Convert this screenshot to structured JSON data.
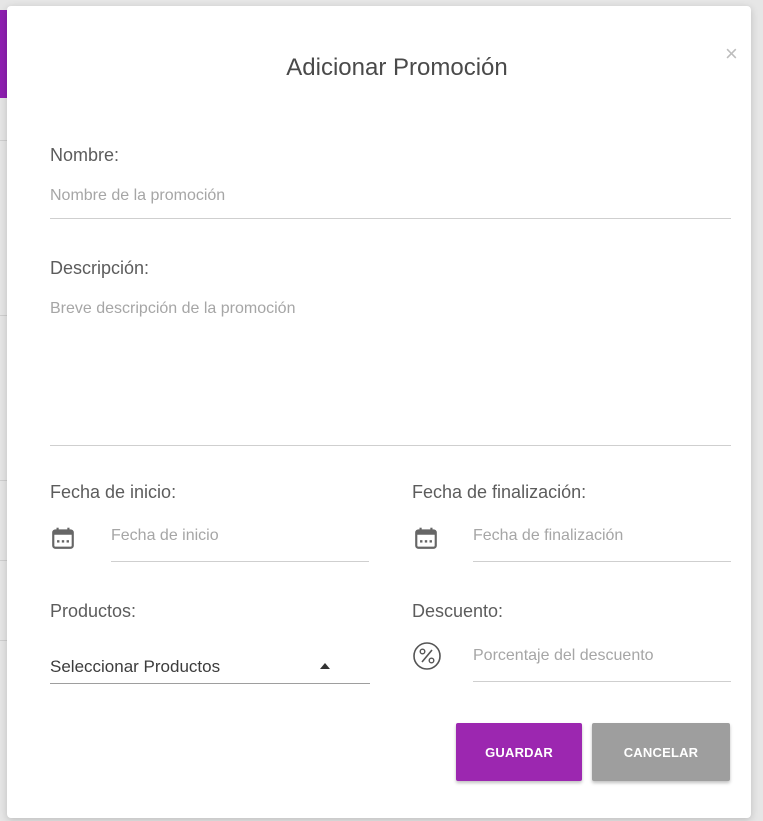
{
  "dialog": {
    "title": "Adicionar Promoción",
    "close_symbol": "×"
  },
  "form": {
    "name": {
      "label": "Nombre:",
      "placeholder": "Nombre de la promoción"
    },
    "description": {
      "label": "Descripción:",
      "placeholder": "Breve descripción de la promoción"
    },
    "start_date": {
      "label": "Fecha de inicio:",
      "placeholder": "Fecha de inicio",
      "icon": "calendar-icon"
    },
    "end_date": {
      "label": "Fecha de finalización:",
      "placeholder": "Fecha de finalización",
      "icon": "calendar-icon"
    },
    "products": {
      "label": "Productos:",
      "selected": "Seleccionar Productos",
      "icon": "caret-up-icon"
    },
    "discount": {
      "label": "Descuento:",
      "placeholder": "Porcentaje del descuento",
      "icon": "percent-icon"
    }
  },
  "actions": {
    "save_label": "GUARDAR",
    "cancel_label": "CANCELAR"
  },
  "colors": {
    "primary": "#9c27b0",
    "secondary": "#9e9e9e"
  }
}
